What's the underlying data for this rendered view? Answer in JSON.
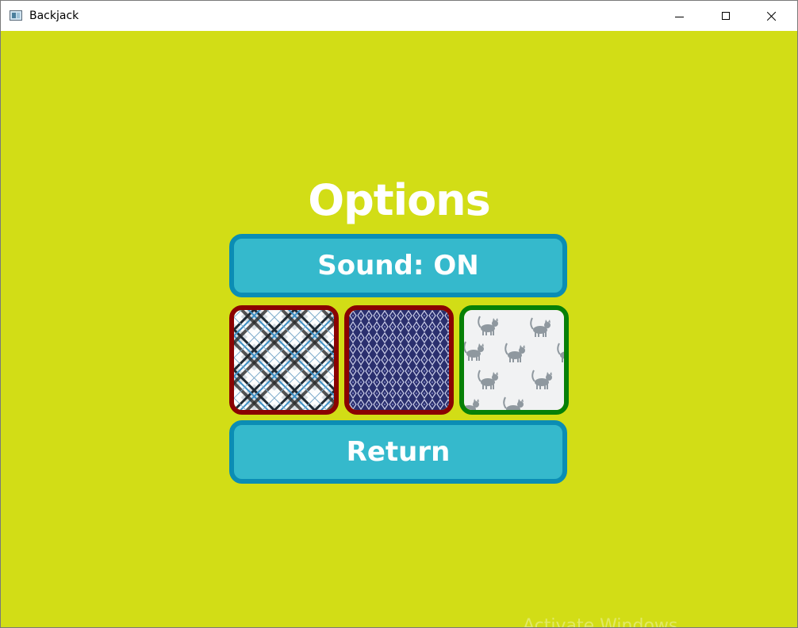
{
  "window": {
    "title": "Backjack",
    "app_icon": "window-app-icon",
    "controls": [
      "minimize-icon",
      "maximize-icon",
      "close-icon"
    ]
  },
  "colors": {
    "background": "#d2dd16",
    "button_fill": "#35b9cc",
    "button_border": "#0b8db4",
    "unselected_border": "#8a0202",
    "selected_border": "#078007",
    "text": "#ffffff"
  },
  "options": {
    "title": "Options",
    "sound_button": "Sound: ON",
    "return_button": "Return",
    "card_backs": [
      {
        "pattern": "plaid",
        "selected": false
      },
      {
        "pattern": "navy-lattice",
        "selected": false
      },
      {
        "pattern": "gray-cats",
        "selected": true
      }
    ]
  },
  "watermark": "Activate Windows"
}
